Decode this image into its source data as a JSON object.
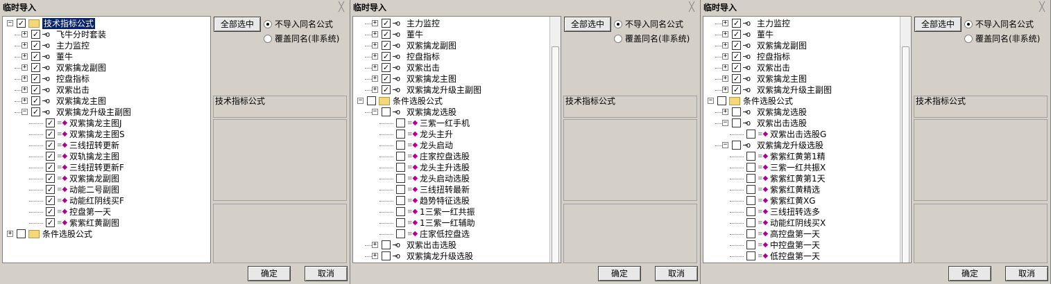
{
  "dialogs": [
    {
      "title": "临时导入",
      "close_label": "╳",
      "select_all_label": "全部选中",
      "radio_no_import": "不导入同名公式",
      "radio_overwrite": "覆盖同名(非系统)",
      "info_label": "技术指标公式",
      "ok_label": "确定",
      "cancel_label": "取消",
      "tree": [
        {
          "level": 0,
          "exp": "−",
          "checked": true,
          "icon": "folder",
          "label": "技术指标公式",
          "selected": true
        },
        {
          "level": 1,
          "exp": "+",
          "checked": true,
          "icon": "key",
          "label": "飞牛分时套装"
        },
        {
          "level": 1,
          "exp": "+",
          "checked": true,
          "icon": "key",
          "label": "主力监控"
        },
        {
          "level": 1,
          "exp": "+",
          "checked": true,
          "icon": "key",
          "label": "董牛"
        },
        {
          "level": 1,
          "exp": "+",
          "checked": true,
          "icon": "key",
          "label": "双紫擒龙副图"
        },
        {
          "level": 1,
          "exp": "+",
          "checked": true,
          "icon": "key",
          "label": "控盘指标"
        },
        {
          "level": 1,
          "exp": "+",
          "checked": true,
          "icon": "key",
          "label": "双紫出击"
        },
        {
          "level": 1,
          "exp": "+",
          "checked": true,
          "icon": "key",
          "label": "双紫擒龙主图"
        },
        {
          "level": 1,
          "exp": "−",
          "checked": true,
          "icon": "key",
          "label": "双紫擒龙升级主副图"
        },
        {
          "level": 2,
          "exp": "",
          "checked": true,
          "icon": "gem",
          "label": "双紫擒龙主图J"
        },
        {
          "level": 2,
          "exp": "",
          "checked": true,
          "icon": "gem",
          "label": "双紫擒龙主图S"
        },
        {
          "level": 2,
          "exp": "",
          "checked": true,
          "icon": "gem",
          "label": "三线扭转更新"
        },
        {
          "level": 2,
          "exp": "",
          "checked": true,
          "icon": "gem",
          "label": "双轨擒龙主图"
        },
        {
          "level": 2,
          "exp": "",
          "checked": true,
          "icon": "gem",
          "label": "三线扭转更新F"
        },
        {
          "level": 2,
          "exp": "",
          "checked": true,
          "icon": "gem",
          "label": "双紫擒龙副图"
        },
        {
          "level": 2,
          "exp": "",
          "checked": true,
          "icon": "gem",
          "label": "动能二号副图"
        },
        {
          "level": 2,
          "exp": "",
          "checked": true,
          "icon": "gem",
          "label": "动能红阴线买F"
        },
        {
          "level": 2,
          "exp": "",
          "checked": true,
          "icon": "gem",
          "label": "控盘第一天"
        },
        {
          "level": 2,
          "exp": "",
          "checked": true,
          "icon": "gem",
          "label": "紫紫红黄副图"
        },
        {
          "level": 0,
          "exp": "+",
          "checked": false,
          "icon": "folder",
          "label": "条件选股公式"
        }
      ]
    },
    {
      "title": "临时导入",
      "close_label": "╳",
      "select_all_label": "全部选中",
      "radio_no_import": "不导入同名公式",
      "radio_overwrite": "覆盖同名(非系统)",
      "info_label": "技术指标公式",
      "ok_label": "确定",
      "cancel_label": "取消",
      "tree": [
        {
          "level": 1,
          "exp": "+",
          "checked": true,
          "icon": "key",
          "label": "主力监控"
        },
        {
          "level": 1,
          "exp": "+",
          "checked": true,
          "icon": "key",
          "label": "董牛"
        },
        {
          "level": 1,
          "exp": "+",
          "checked": true,
          "icon": "key",
          "label": "双紫擒龙副图"
        },
        {
          "level": 1,
          "exp": "+",
          "checked": true,
          "icon": "key",
          "label": "控盘指标"
        },
        {
          "level": 1,
          "exp": "+",
          "checked": true,
          "icon": "key",
          "label": "双紫出击"
        },
        {
          "level": 1,
          "exp": "+",
          "checked": true,
          "icon": "key",
          "label": "双紫擒龙主图"
        },
        {
          "level": 1,
          "exp": "+",
          "checked": true,
          "icon": "key",
          "label": "双紫擒龙升级主副图"
        },
        {
          "level": 0,
          "exp": "−",
          "checked": false,
          "icon": "folder",
          "label": "条件选股公式"
        },
        {
          "level": 1,
          "exp": "−",
          "checked": false,
          "icon": "key",
          "label": "双紫擒龙选股"
        },
        {
          "level": 2,
          "exp": "",
          "checked": false,
          "icon": "gem",
          "label": "三紫一红手机"
        },
        {
          "level": 2,
          "exp": "",
          "checked": false,
          "icon": "gem",
          "label": "龙头主升"
        },
        {
          "level": 2,
          "exp": "",
          "checked": false,
          "icon": "gem",
          "label": "龙头启动"
        },
        {
          "level": 2,
          "exp": "",
          "checked": false,
          "icon": "gem",
          "label": "庄家控盘选股"
        },
        {
          "level": 2,
          "exp": "",
          "checked": false,
          "icon": "gem",
          "label": "龙头主升选股"
        },
        {
          "level": 2,
          "exp": "",
          "checked": false,
          "icon": "gem",
          "label": "龙头启动选股"
        },
        {
          "level": 2,
          "exp": "",
          "checked": false,
          "icon": "gem",
          "label": "三线扭转最新"
        },
        {
          "level": 2,
          "exp": "",
          "checked": false,
          "icon": "gem",
          "label": "趋势特征选股"
        },
        {
          "level": 2,
          "exp": "",
          "checked": false,
          "icon": "gem",
          "label": "1三紫一红共振"
        },
        {
          "level": 2,
          "exp": "",
          "checked": false,
          "icon": "gem",
          "label": "1三紫一红辅助"
        },
        {
          "level": 2,
          "exp": "",
          "checked": false,
          "icon": "gem",
          "label": "庄家低控盘选"
        },
        {
          "level": 1,
          "exp": "+",
          "checked": false,
          "icon": "key",
          "label": "双紫出击选股"
        },
        {
          "level": 1,
          "exp": "+",
          "checked": false,
          "icon": "key",
          "label": "双紫擒龙升级选股"
        }
      ]
    },
    {
      "title": "临时导入",
      "close_label": "╳",
      "select_all_label": "全部选中",
      "radio_no_import": "不导入同名公式",
      "radio_overwrite": "覆盖同名(非系统)",
      "info_label": "技术指标公式",
      "ok_label": "确定",
      "cancel_label": "取消",
      "tree": [
        {
          "level": 1,
          "exp": "+",
          "checked": true,
          "icon": "key",
          "label": "主力监控"
        },
        {
          "level": 1,
          "exp": "+",
          "checked": true,
          "icon": "key",
          "label": "董牛"
        },
        {
          "level": 1,
          "exp": "+",
          "checked": true,
          "icon": "key",
          "label": "双紫擒龙副图"
        },
        {
          "level": 1,
          "exp": "+",
          "checked": true,
          "icon": "key",
          "label": "控盘指标"
        },
        {
          "level": 1,
          "exp": "+",
          "checked": true,
          "icon": "key",
          "label": "双紫出击"
        },
        {
          "level": 1,
          "exp": "+",
          "checked": true,
          "icon": "key",
          "label": "双紫擒龙主图"
        },
        {
          "level": 1,
          "exp": "+",
          "checked": true,
          "icon": "key",
          "label": "双紫擒龙升级主副图"
        },
        {
          "level": 0,
          "exp": "−",
          "checked": false,
          "icon": "folder",
          "label": "条件选股公式"
        },
        {
          "level": 1,
          "exp": "+",
          "checked": false,
          "icon": "key",
          "label": "双紫擒龙选股"
        },
        {
          "level": 1,
          "exp": "−",
          "checked": false,
          "icon": "key",
          "label": "双紫出击选股"
        },
        {
          "level": 2,
          "exp": "",
          "checked": false,
          "icon": "gem",
          "label": "双紫出击选股G"
        },
        {
          "level": 1,
          "exp": "−",
          "checked": false,
          "icon": "key",
          "label": "双紫擒龙升级选股"
        },
        {
          "level": 2,
          "exp": "",
          "checked": false,
          "icon": "gem",
          "label": "紫紫红黄第1精"
        },
        {
          "level": 2,
          "exp": "",
          "checked": false,
          "icon": "gem",
          "label": "三紫一红共振X"
        },
        {
          "level": 2,
          "exp": "",
          "checked": false,
          "icon": "gem",
          "label": "紫紫红黄第1天"
        },
        {
          "level": 2,
          "exp": "",
          "checked": false,
          "icon": "gem",
          "label": "紫紫红黄精选"
        },
        {
          "level": 2,
          "exp": "",
          "checked": false,
          "icon": "gem",
          "label": "紫紫红黄XG"
        },
        {
          "level": 2,
          "exp": "",
          "checked": false,
          "icon": "gem",
          "label": "三线扭转选多"
        },
        {
          "level": 2,
          "exp": "",
          "checked": false,
          "icon": "gem",
          "label": "动能红阴线买X"
        },
        {
          "level": 2,
          "exp": "",
          "checked": false,
          "icon": "gem",
          "label": "高控盘第一天"
        },
        {
          "level": 2,
          "exp": "",
          "checked": false,
          "icon": "gem",
          "label": "中控盘第一天"
        },
        {
          "level": 2,
          "exp": "",
          "checked": false,
          "icon": "gem",
          "label": "低控盘第一天"
        }
      ]
    }
  ],
  "colors": {
    "selection": "#0a246a",
    "gem": "#b0008c",
    "folder": "#f4d77a"
  },
  "icons": {
    "folder": "folder-icon",
    "key": "formula-key-icon",
    "gem": "formula-item-icon"
  }
}
